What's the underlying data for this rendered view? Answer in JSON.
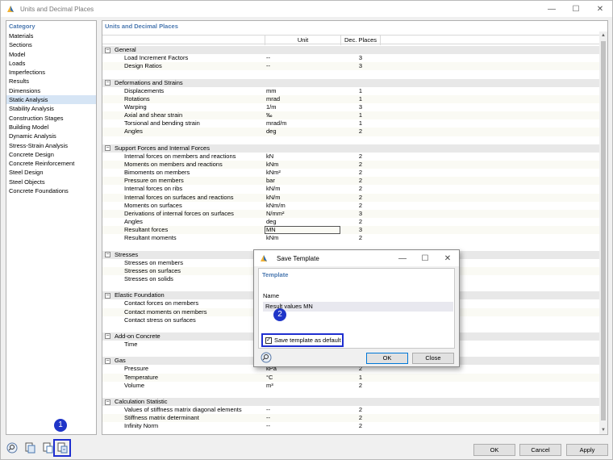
{
  "window": {
    "title": "Units and Decimal Places",
    "controls": [
      "minimize-icon",
      "maximize-icon",
      "close-icon"
    ]
  },
  "category": {
    "header": "Category",
    "selected": "Static Analysis",
    "items": [
      "Materials",
      "Sections",
      "Model",
      "Loads",
      "Imperfections",
      "Results",
      "Dimensions",
      "Static Analysis",
      "Stability Analysis",
      "Construction Stages",
      "Building Model",
      "Dynamic Analysis",
      "Stress-Strain Analysis",
      "Concrete Design",
      "Concrete Reinforcement",
      "Steel Design",
      "Steel Objects",
      "Concrete Foundations"
    ]
  },
  "main": {
    "header": "Units and Decimal Places",
    "col_unit": "Unit",
    "col_dec": "Dec. Places",
    "toggle_symbol": "−",
    "groups": [
      {
        "name": "General",
        "items": [
          {
            "name": "Load Increment Factors",
            "unit": "--",
            "dec": "3"
          },
          {
            "name": "Design Ratios",
            "unit": "--",
            "dec": "3"
          }
        ]
      },
      {
        "name": "Deformations and Strains",
        "items": [
          {
            "name": "Displacements",
            "unit": "mm",
            "dec": "1"
          },
          {
            "name": "Rotations",
            "unit": "mrad",
            "dec": "1"
          },
          {
            "name": "Warping",
            "unit": "1/m",
            "dec": "3"
          },
          {
            "name": "Axial and shear strain",
            "unit": "‰",
            "dec": "1"
          },
          {
            "name": "Torsional and bending strain",
            "unit": "mrad/m",
            "dec": "1"
          },
          {
            "name": "Angles",
            "unit": "deg",
            "dec": "2"
          }
        ]
      },
      {
        "name": "Support Forces and Internal Forces",
        "items": [
          {
            "name": "Internal forces on members and reactions",
            "unit": "kN",
            "dec": "2"
          },
          {
            "name": "Moments on members and reactions",
            "unit": "kNm",
            "dec": "2"
          },
          {
            "name": "Bimoments on members",
            "unit": "kNm²",
            "dec": "2"
          },
          {
            "name": "Pressure on members",
            "unit": "bar",
            "dec": "2"
          },
          {
            "name": "Internal forces on ribs",
            "unit": "kN/m",
            "dec": "2"
          },
          {
            "name": "Internal forces on surfaces and reactions",
            "unit": "kN/m",
            "dec": "2"
          },
          {
            "name": "Moments on surfaces",
            "unit": "kNm/m",
            "dec": "2"
          },
          {
            "name": "Derivations of internal forces on surfaces",
            "unit": "N/mm²",
            "dec": "3"
          },
          {
            "name": "Angles",
            "unit": "deg",
            "dec": "2"
          },
          {
            "name": "Resultant forces",
            "unit": "MN",
            "dec": "3",
            "editing": true
          },
          {
            "name": "Resultant moments",
            "unit": "kNm",
            "dec": "2"
          }
        ]
      },
      {
        "name": "Stresses",
        "items": [
          {
            "name": "Stresses on members",
            "unit": "",
            "dec": ""
          },
          {
            "name": "Stresses on surfaces",
            "unit": "",
            "dec": ""
          },
          {
            "name": "Stresses on solids",
            "unit": "",
            "dec": ""
          }
        ]
      },
      {
        "name": "Elastic Foundation",
        "items": [
          {
            "name": "Contact forces on members",
            "unit": "",
            "dec": ""
          },
          {
            "name": "Contact moments on members",
            "unit": "",
            "dec": ""
          },
          {
            "name": "Contact stress on surfaces",
            "unit": "",
            "dec": ""
          }
        ]
      },
      {
        "name": "Add-on Concrete",
        "items": [
          {
            "name": "Time",
            "unit": "",
            "dec": ""
          }
        ]
      },
      {
        "name": "Gas",
        "items": [
          {
            "name": "Pressure",
            "unit": "kPa",
            "dec": "2"
          },
          {
            "name": "Temperature",
            "unit": "°C",
            "dec": "1"
          },
          {
            "name": "Volume",
            "unit": "m³",
            "dec": "2"
          }
        ]
      },
      {
        "name": "Calculation Statistic",
        "items": [
          {
            "name": "Values of stiffness matrix diagonal elements",
            "unit": "--",
            "dec": "2"
          },
          {
            "name": "Stiffness matrix determinant",
            "unit": "--",
            "dec": "2"
          },
          {
            "name": "Infinity Norm",
            "unit": "--",
            "dec": "2"
          }
        ]
      }
    ]
  },
  "footer": {
    "ok": "OK",
    "cancel": "Cancel",
    "apply": "Apply",
    "tools": [
      "search-icon",
      "load-template-icon",
      "copy-template-icon",
      "save-template-icon"
    ]
  },
  "badges": {
    "b1": "1",
    "b2": "2"
  },
  "save_dialog": {
    "title": "Save Template",
    "section": "Template",
    "name_label": "Name",
    "name_value": "Result values MN",
    "checkbox_label": "Save template as default",
    "checkbox_checked": true,
    "ok": "OK",
    "close": "Close"
  },
  "colors": {
    "accent": "#4a78b0",
    "highlight": "#1f2fd0",
    "selected_row": "#d6e5f5"
  }
}
